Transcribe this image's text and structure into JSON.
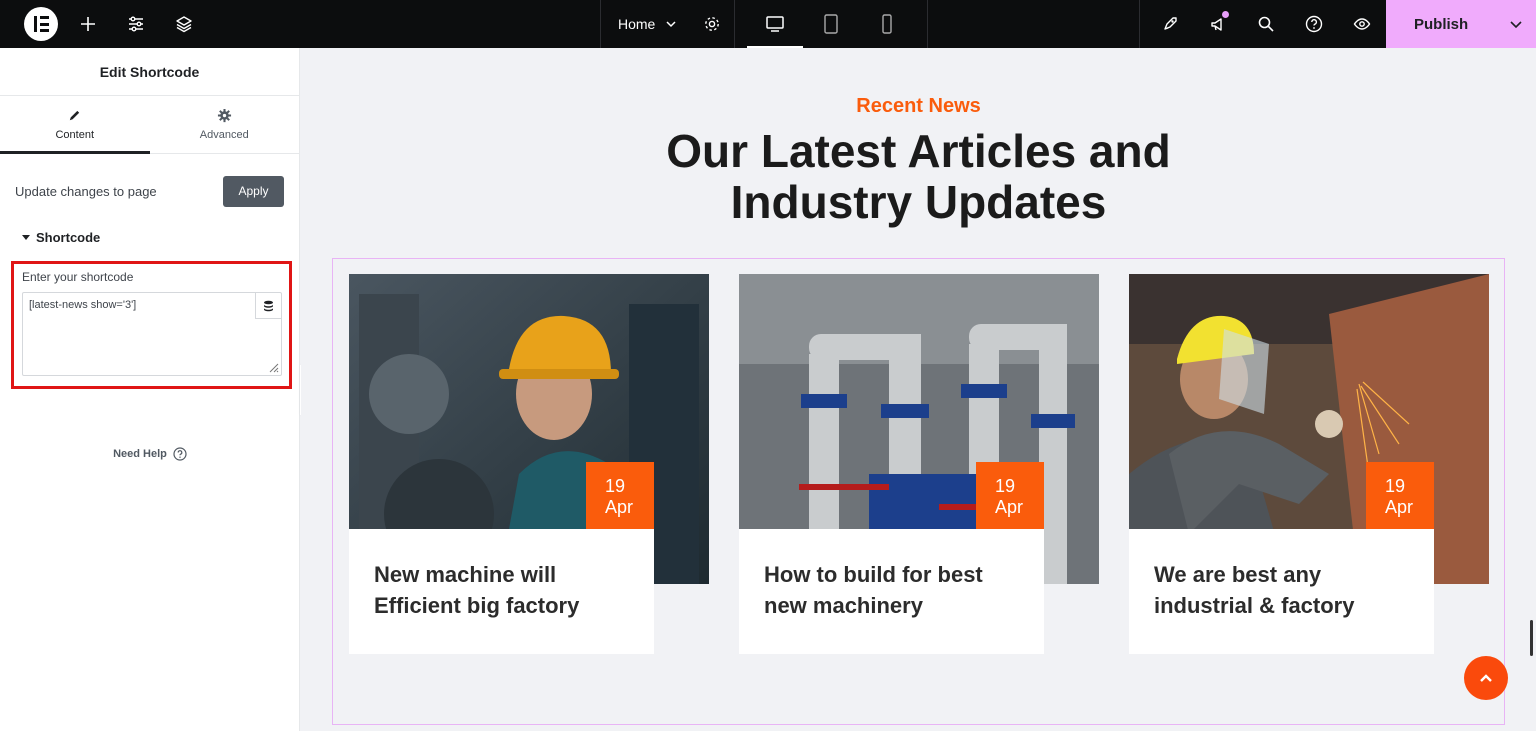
{
  "topbar": {
    "page_name": "Home",
    "publish_label": "Publish"
  },
  "sidebar": {
    "title": "Edit Shortcode",
    "tabs": [
      {
        "label": "Content",
        "icon": "pencil-icon"
      },
      {
        "label": "Advanced",
        "icon": "gear-icon"
      }
    ],
    "update_text": "Update changes to page",
    "apply_label": "Apply",
    "section_title": "Shortcode",
    "shortcode_label": "Enter your shortcode",
    "shortcode_value": "[latest-news show='3']",
    "need_help": "Need Help"
  },
  "canvas": {
    "eyebrow": "Recent News",
    "heading_line1": "Our Latest Articles and",
    "heading_line2": "Industry Updates",
    "cards": [
      {
        "day": "19",
        "month": "Apr",
        "title_line1": "New machine will",
        "title_line2": "Efficient big factory"
      },
      {
        "day": "19",
        "month": "Apr",
        "title_line1": "How to build for best",
        "title_line2": "new machinery"
      },
      {
        "day": "19",
        "month": "Apr",
        "title_line1": "We are best any",
        "title_line2": "industrial & factory"
      }
    ]
  },
  "colors": {
    "accent": "#fa5c0c",
    "publish": "#f0abfc",
    "highlight": "#e01515"
  }
}
